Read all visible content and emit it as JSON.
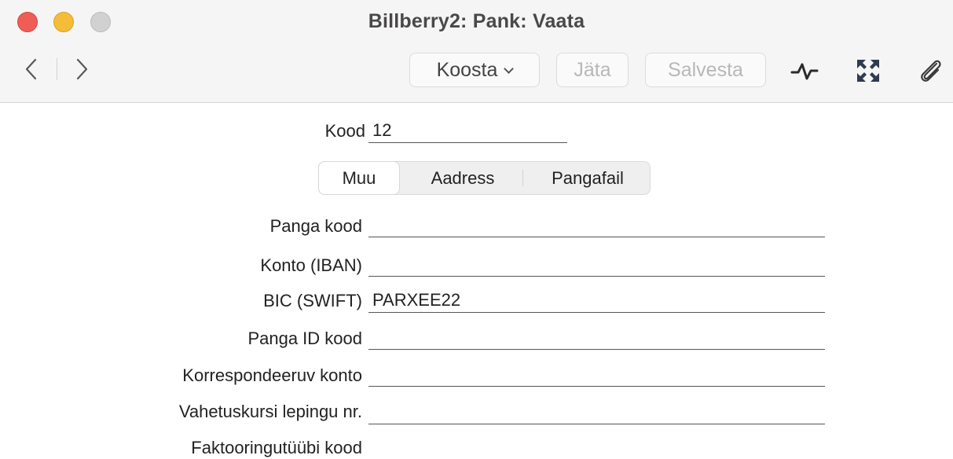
{
  "window": {
    "title": "Billberry2: Pank: Vaata"
  },
  "toolbar": {
    "koosta_label": "Koosta",
    "jata_label": "Jäta",
    "salvesta_label": "Salvesta"
  },
  "form": {
    "kood_label": "Kood",
    "kood_value": "12",
    "tabs": [
      {
        "label": "Muu",
        "active": true
      },
      {
        "label": "Aadress",
        "active": false
      },
      {
        "label": "Pangafail",
        "active": false
      }
    ],
    "fields": [
      {
        "label": "Panga kood",
        "value": ""
      },
      {
        "label": "Konto (IBAN)",
        "value": ""
      },
      {
        "label": "BIC (SWIFT)",
        "value": "PARXEE22"
      },
      {
        "label": "Panga ID kood",
        "value": ""
      },
      {
        "label": "Korrespondeeruv konto",
        "value": ""
      },
      {
        "label": "Vahetuskursi lepingu nr.",
        "value": ""
      },
      {
        "label": "Faktooringutüübi kood",
        "value": ""
      }
    ]
  },
  "colors": {
    "close": "#ee5e56",
    "minimize": "#f4bd39",
    "zoom": "#d2d1d1",
    "disabled_text": "#b9b7b7",
    "expand_icon": "#2f3b4f"
  }
}
